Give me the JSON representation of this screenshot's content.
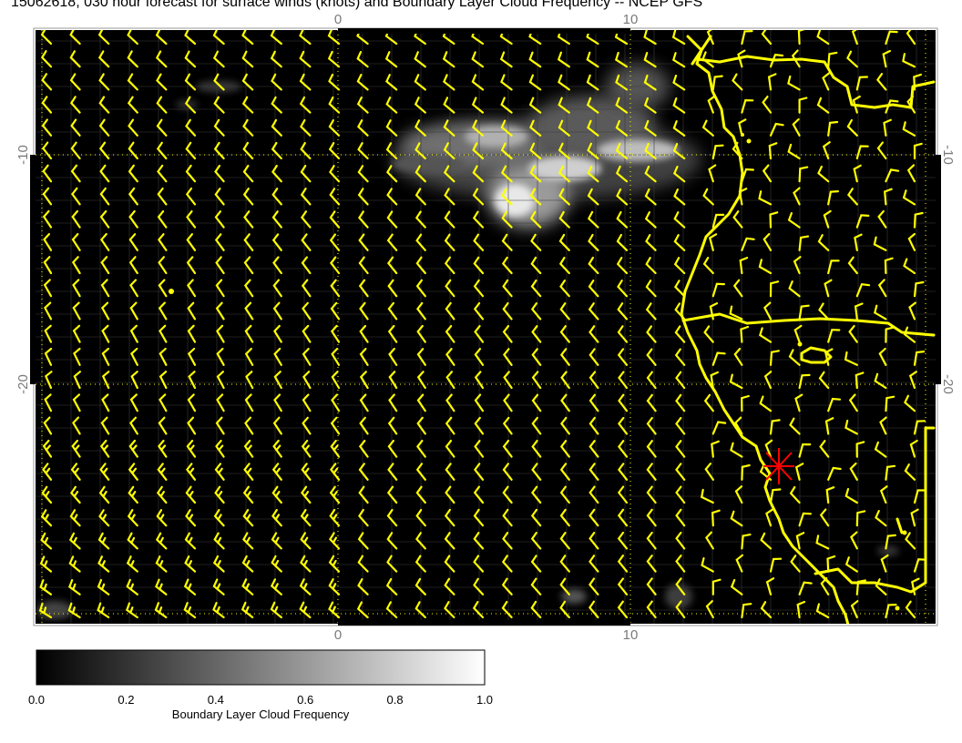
{
  "title": "15062618, 030 hour forecast for surface winds (knots) and Boundary Layer Cloud Frequency -- NCEP GFS",
  "axes": {
    "x_ticks": [
      "0",
      "10"
    ],
    "y_ticks": [
      "-10",
      "-20"
    ]
  },
  "colorbar": {
    "label": "Boundary Layer Cloud Frequency",
    "ticks": [
      "0.0",
      "0.2",
      "0.4",
      "0.6",
      "0.8",
      "1.0"
    ],
    "range": [
      0.0,
      1.0
    ],
    "colormap": "black-to-white"
  },
  "colors": {
    "map_background": "#000000",
    "wind_barbs": "#ffff00",
    "coastline": "#ffff00",
    "gridlines": "#ffff00",
    "marker": "#ff0000"
  },
  "layers": {
    "wind_barbs": "surface winds (knots)",
    "shading": "Boundary Layer Cloud Frequency",
    "marker": "red-asterisk"
  }
}
